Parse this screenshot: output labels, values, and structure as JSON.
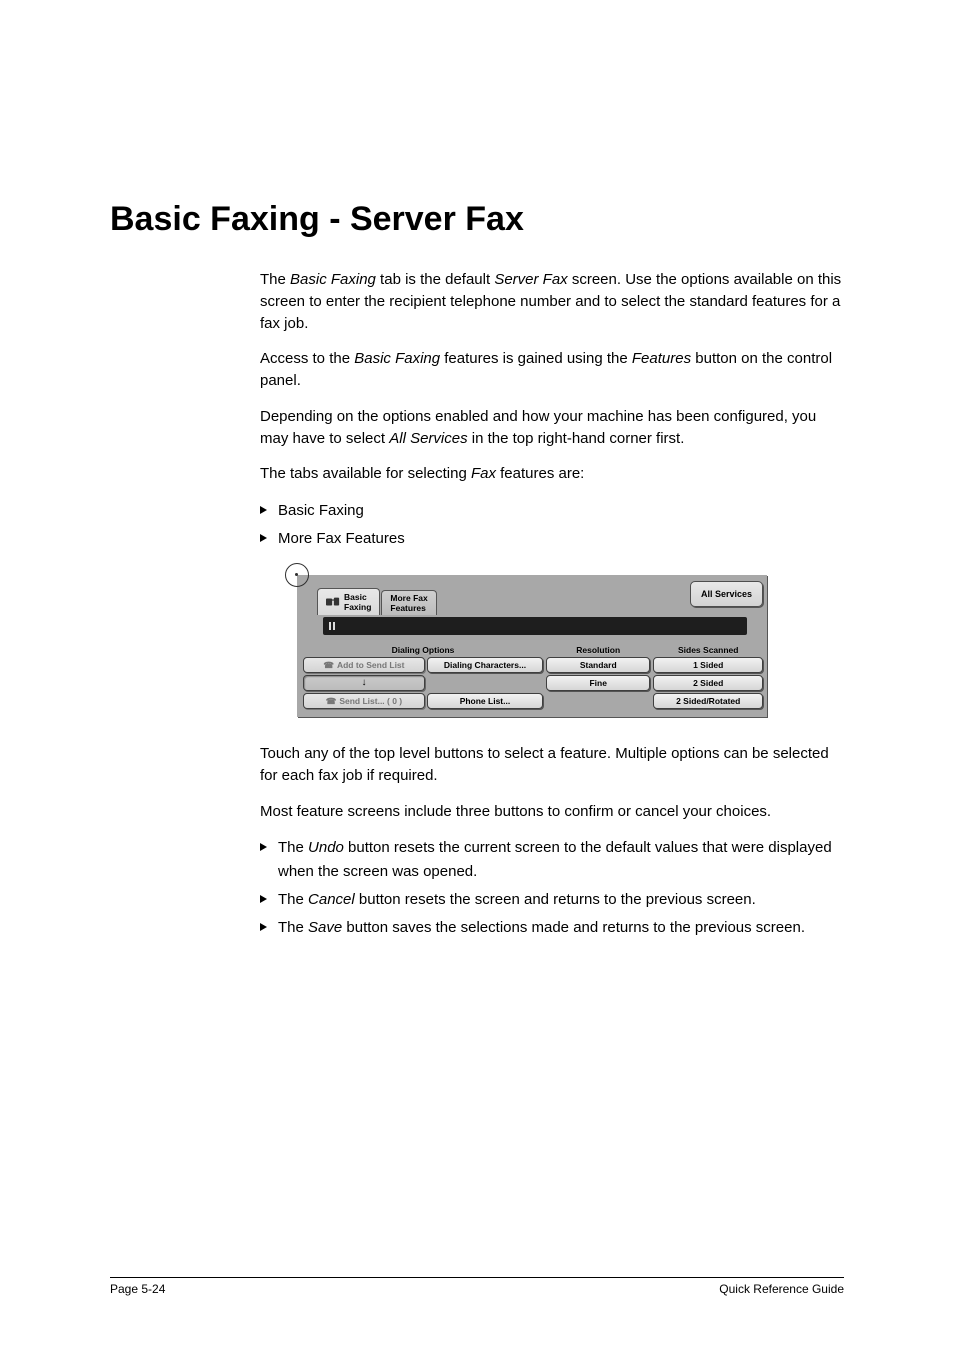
{
  "title": "Basic Faxing - Server Fax",
  "paragraphs": {
    "p1a": "The ",
    "p1_em1": "Basic Faxing",
    "p1b": " tab is the default ",
    "p1_em2": "Server Fax",
    "p1c": " screen. Use the options available on this screen to enter the recipient telephone number and to select the standard features for a fax job.",
    "p2a": "Access to the ",
    "p2_em1": "Basic Faxing",
    "p2b": " features is gained using the ",
    "p2_em2": "Features",
    "p2c": " button on the control panel.",
    "p3a": "Depending on the options enabled and how your machine has been configured, you may have to select ",
    "p3_em1": "All Services",
    "p3b": " in the top right-hand corner first.",
    "p4a": "The tabs available for selecting ",
    "p4_em1": "Fax",
    "p4b": " features are:"
  },
  "tabs_list": {
    "i1": "Basic Faxing",
    "i2": "More Fax Features"
  },
  "after": {
    "p5": "Touch any of the top level buttons to select a feature. Multiple options can be selected for each fax job if required.",
    "p6": "Most feature screens include three buttons to confirm or cancel your choices.",
    "b1a": "The ",
    "b1_em": "Undo",
    "b1b": " button resets the current screen to the default values that were displayed when the screen was opened.",
    "b2a": "The ",
    "b2_em": "Cancel",
    "b2b": " button resets the screen and returns to the previous screen.",
    "b3a": "The ",
    "b3_em": "Save",
    "b3b": " button saves the selections made and returns to the previous screen."
  },
  "fax_screen": {
    "tab_basic_l1": "Basic",
    "tab_basic_l2": "Faxing",
    "tab_more_l1": "More Fax",
    "tab_more_l2": "Features",
    "all_services": "All Services",
    "headers": {
      "dialing": "Dialing Options",
      "resolution": "Resolution",
      "sides": "Sides Scanned"
    },
    "buttons": {
      "add_to_send": "Add to Send List",
      "dialing_chars": "Dialing Characters...",
      "arrow": "↓",
      "send_list": "Send List... ( 0 )",
      "phone_list": "Phone List...",
      "standard": "Standard",
      "fine": "Fine",
      "one_sided": "1 Sided",
      "two_sided": "2 Sided",
      "two_sided_rot": "2 Sided/Rotated"
    }
  },
  "footer": {
    "left": "Page 5-24",
    "right": "Quick Reference Guide"
  }
}
